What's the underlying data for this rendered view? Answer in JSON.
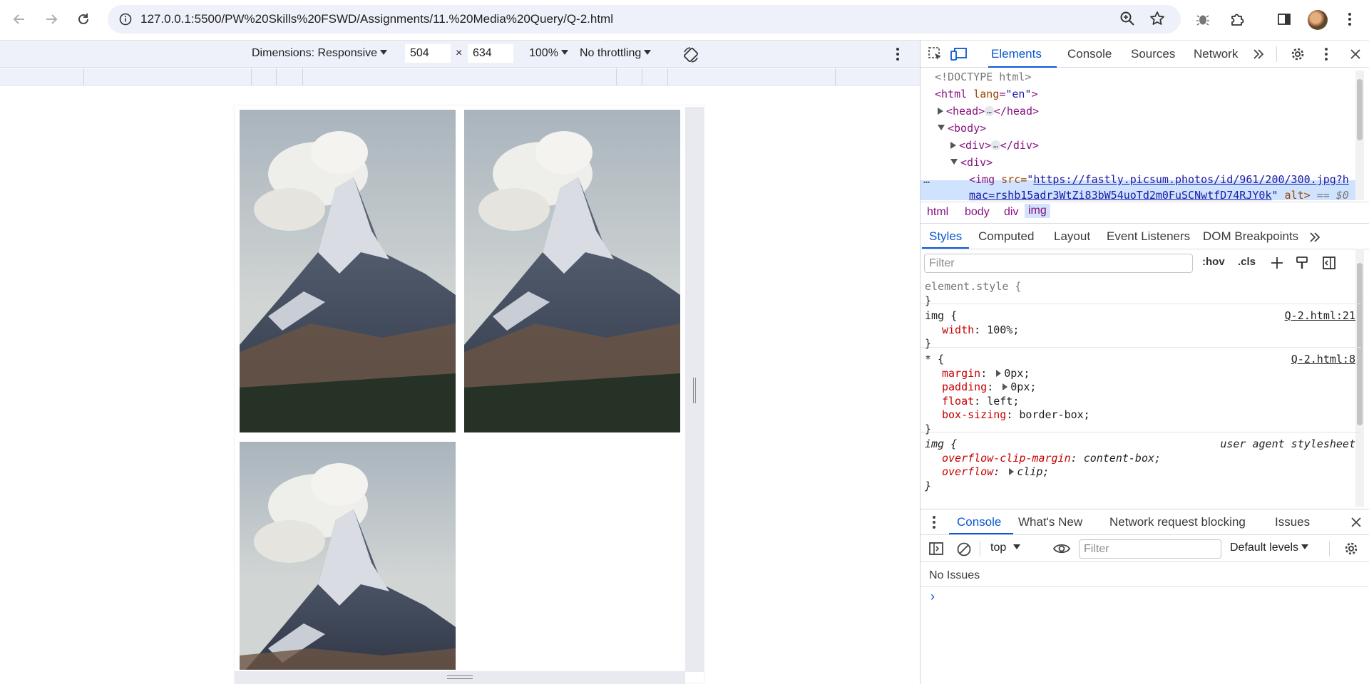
{
  "browser": {
    "url": "127.0.0.1:5500/PW%20Skills%20FSWD/Assignments/11.%20Media%20Query/Q-2.html"
  },
  "device_toolbar": {
    "dimensions_label": "Dimensions: Responsive",
    "width": "504",
    "times": "×",
    "height": "634",
    "zoom": "100%",
    "throttling": "No throttling"
  },
  "devtools": {
    "tabs": [
      "Elements",
      "Console",
      "Sources",
      "Network"
    ],
    "dom": {
      "doctype": "<!DOCTYPE html>",
      "html_open_tag": "<html",
      "html_attr_name": "lang",
      "html_attr_value": "\"en\"",
      "head_open": "<head>",
      "head_close": "</head>",
      "body_open": "<body>",
      "div_open": "<div>",
      "div_close": "</div>",
      "img_open": "<img",
      "img_src_attr": "src=",
      "img_src_url_line1": "https://fastly.picsum.photos/id/961/200/300.jpg?h",
      "img_src_url_line2": "mac=rshb15adr3WtZi83bW54uoTd2m0FuSCNwtfD74RJY0k",
      "img_alt_attr": "alt>",
      "selected_marker": "== $0",
      "ellipsis": "…"
    },
    "breadcrumb": [
      "html",
      "body",
      "div",
      "img"
    ],
    "styles_tabs": [
      "Styles",
      "Computed",
      "Layout",
      "Event Listeners",
      "DOM Breakpoints"
    ],
    "filter_placeholder": "Filter",
    "hov": ":hov",
    "cls": ".cls",
    "rules": {
      "element_style": "element.style {",
      "close": "}",
      "img_selector": "img {",
      "img_source": "Q-2.html:21",
      "img_prop_name": "width",
      "img_prop_value": "100%;",
      "star_selector": "* {",
      "star_source": "Q-2.html:8",
      "star_props": [
        {
          "name": "margin",
          "value": "0px;",
          "expandable": true
        },
        {
          "name": "padding",
          "value": "0px;",
          "expandable": true
        },
        {
          "name": "float",
          "value": "left;",
          "expandable": false
        },
        {
          "name": "box-sizing",
          "value": "border-box;",
          "expandable": false
        }
      ],
      "ua_selector": "img {",
      "ua_source": "user agent stylesheet",
      "ua_props": [
        {
          "name": "overflow-clip-margin",
          "value": "content-box;",
          "expandable": false
        },
        {
          "name": "overflow",
          "value": "clip;",
          "expandable": true
        }
      ]
    },
    "drawer_tabs": [
      "Console",
      "What's New",
      "Network request blocking",
      "Issues"
    ],
    "console": {
      "context": "top",
      "filter_placeholder": "Filter",
      "levels": "Default levels",
      "no_issues": "No Issues",
      "prompt": "›"
    }
  },
  "colors": {
    "accent": "#0b57d0",
    "tag": "#881280",
    "attr": "#994500",
    "prop": "#c80000"
  }
}
